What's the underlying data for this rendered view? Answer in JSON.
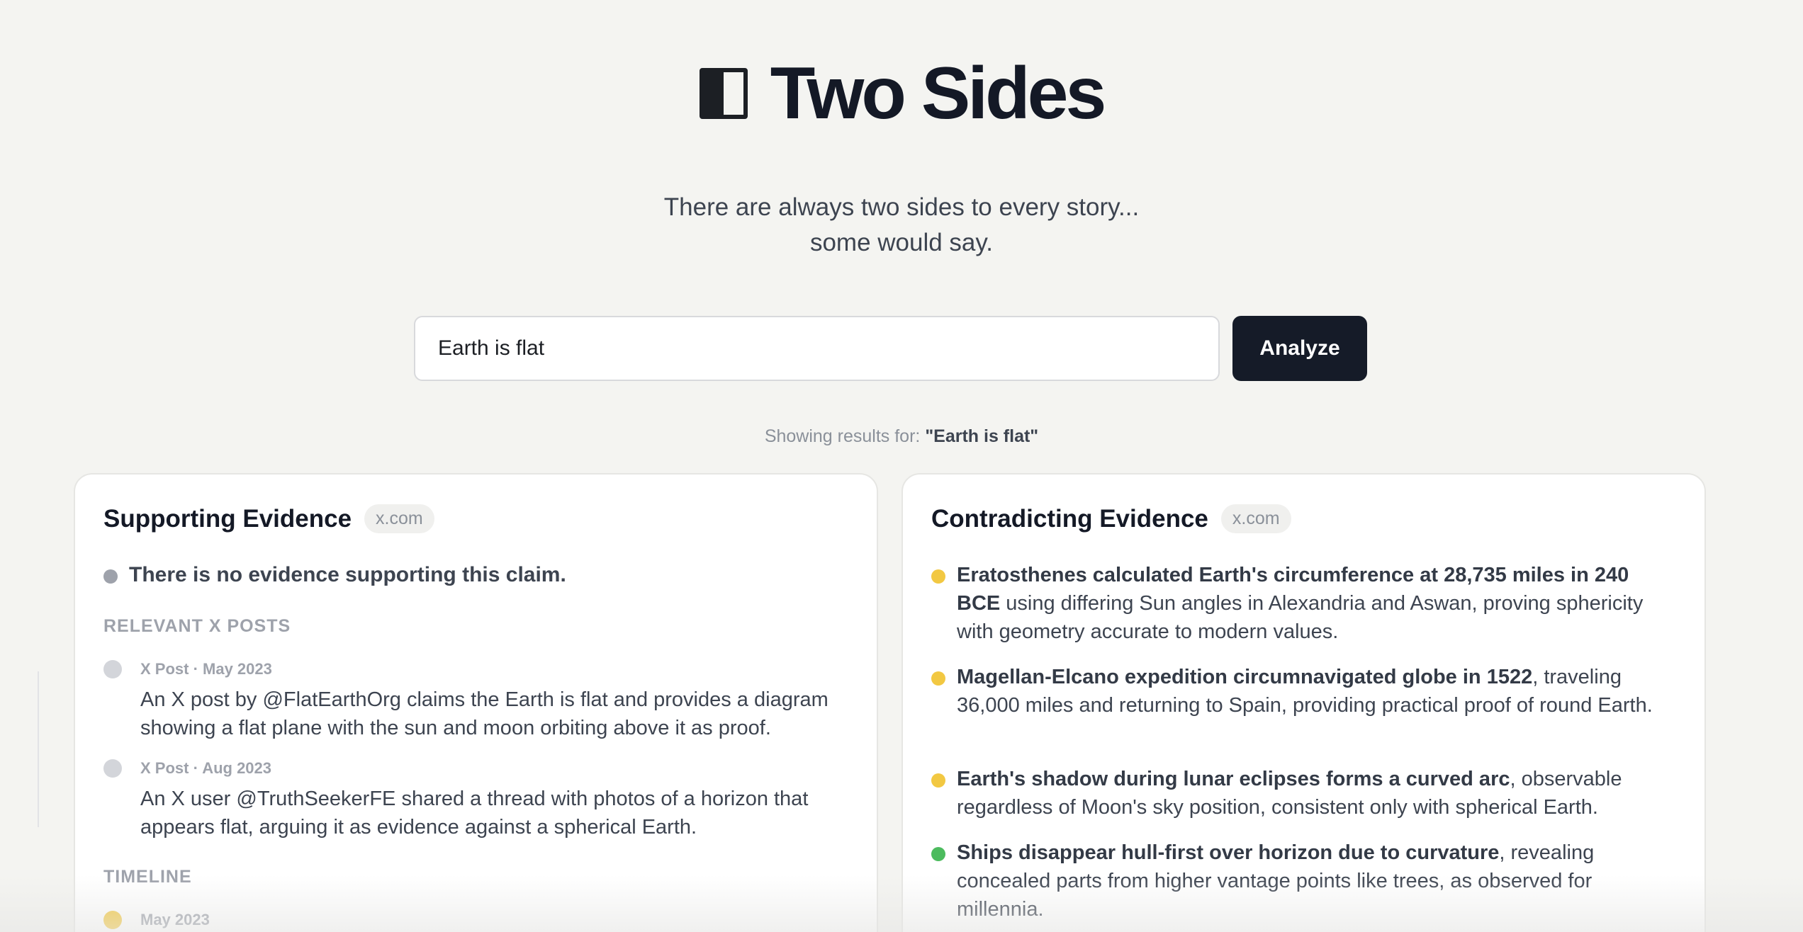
{
  "header": {
    "logo_icon": "half-square-icon",
    "title": "Two Sides",
    "subtitle_line1": "There are always two sides to every story...",
    "subtitle_line2": "some would say."
  },
  "search": {
    "value": "Earth is flat",
    "placeholder": "",
    "button_label": "Analyze"
  },
  "results": {
    "prefix": "Showing results for:",
    "query": "\"Earth is flat\""
  },
  "supporting": {
    "title": "Supporting Evidence",
    "source": "x.com",
    "no_evidence": "There is no evidence supporting this claim.",
    "posts_label": "RELEVANT X POSTS",
    "posts": [
      {
        "meta": "X Post · May 2023",
        "text": "An X post by @FlatEarthOrg claims the Earth is flat and provides a diagram showing a flat plane with the sun and moon orbiting above it as proof."
      },
      {
        "meta": "X Post · Aug 2023",
        "text": "An X user @TruthSeekerFE shared a thread with photos of a horizon that appears flat, arguing it as evidence against a spherical Earth."
      }
    ],
    "timeline_label": "TIMELINE",
    "timeline": [
      {
        "date": "May 2023"
      }
    ]
  },
  "contradicting": {
    "title": "Contradicting Evidence",
    "source": "x.com",
    "items": [
      {
        "bold": "Eratosthenes calculated Earth's circumference at 28,735 miles in 240 BCE",
        "rest": " using differing Sun angles in Alexandria and Aswan, proving sphericity with geometry accurate to modern values.",
        "status_color": "#f2c842"
      },
      {
        "bold": "Magellan-Elcano expedition circumnavigated globe in 1522",
        "rest": ", traveling 36,000 miles and returning to Spain, providing practical proof of round Earth.",
        "status_color": "#f2c842"
      },
      {
        "bold": "Earth's shadow during lunar eclipses forms a curved arc",
        "rest": ", observable regardless of Moon's sky position, consistent only with spherical Earth.",
        "status_color": "#f2c842"
      },
      {
        "bold": "Ships disappear hull-first over horizon due to curvature",
        "rest": ", revealing concealed parts from higher vantage points like trees, as observed for millennia.",
        "status_color": "#4cbb5e"
      }
    ]
  },
  "colors": {
    "background": "#f4f4f1",
    "primary_dark": "#151b28",
    "dot_yellow": "#f2c842",
    "dot_green": "#4cbb5e",
    "dot_gray": "#9ea2ab"
  }
}
